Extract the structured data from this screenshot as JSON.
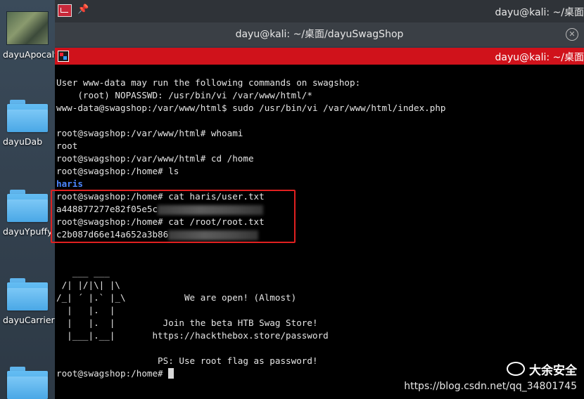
{
  "desktop": {
    "items": [
      {
        "label": "dayuApocalys",
        "kind": "thumb"
      },
      {
        "label": "dayuDab",
        "kind": "folder"
      },
      {
        "label": "dayuYpuffy",
        "kind": "folder"
      },
      {
        "label": "dayuCarrier",
        "kind": "folder"
      },
      {
        "label": "",
        "kind": "folder"
      }
    ]
  },
  "back_window": {
    "top_title": "dayu@kali: ~/桌面",
    "subtitle": "dayu@kali: ~/桌面/dayuSwagShop",
    "close_symbol": "✕"
  },
  "terminal": {
    "title": "dayu@kali: ~/桌面",
    "lines": [
      "User www-data may run the following commands on swagshop:",
      "    (root) NOPASSWD: /usr/bin/vi /var/www/html/*",
      "www-data@swagshop:/var/www/html$ sudo /usr/bin/vi /var/www/html/index.php",
      "",
      "root@swagshop:/var/www/html# whoami",
      "root",
      "root@swagshop:/var/www/html# cd /home",
      "root@swagshop:/home# ls",
      "haris",
      "root@swagshop:/home# cat haris/user.txt",
      "a448877277e82f05e5c",
      "root@swagshop:/home# cat /root/root.txt",
      "c2b087d66e14a652a3b86",
      "",
      "",
      "   ___ ___",
      " /| |/|\\| |\\",
      "/_| ´ |.` |_\\           We are open! (Almost)",
      "  |   |.  |",
      "  |   |.  |         Join the beta HTB Swag Store!",
      "  |___|.__|       https://hackthebox.store/password",
      "",
      "                   PS: Use root flag as password!",
      "root@swagshop:/home# "
    ],
    "blue_line_index": 8,
    "redacted_line_indices": [
      10,
      12
    ],
    "cursor_line_index": 23
  },
  "watermark": {
    "brand": "大余安全",
    "url": "https://blog.csdn.net/qq_34801745"
  },
  "colors": {
    "terminal_title_bar": "#d0121b",
    "highlight_box": "#e02020",
    "dir_listing": "#4c86ff"
  }
}
